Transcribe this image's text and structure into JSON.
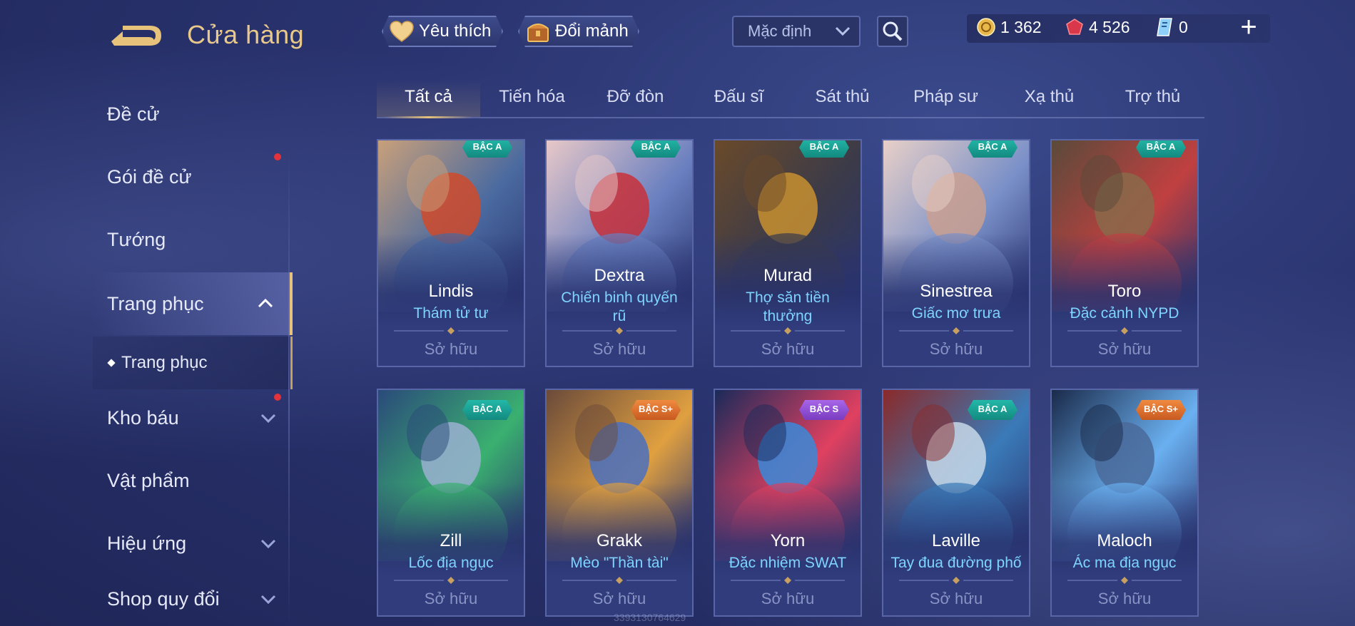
{
  "header": {
    "title": "Cửa hàng",
    "favorites_label": "Yêu thích",
    "fragments_label": "Đổi mảnh",
    "sort_value": "Mặc định",
    "currency": {
      "gold": "1 362",
      "ruby": "4 526",
      "voucher": "0"
    },
    "add_symbol": "+"
  },
  "sidebar": {
    "items": [
      {
        "label": "Đề cử"
      },
      {
        "label": "Gói đề cử"
      },
      {
        "label": "Tướng"
      },
      {
        "label": "Trang phục"
      },
      {
        "label": "Trang phục"
      },
      {
        "label": "Kho báu"
      },
      {
        "label": "Vật phẩm"
      },
      {
        "label": "Hiệu ứng"
      },
      {
        "label": "Shop quy đổi"
      }
    ]
  },
  "tabs": [
    "Tất cả",
    "Tiến hóa",
    "Đỡ đòn",
    "Đấu sĩ",
    "Sát thủ",
    "Pháp sư",
    "Xạ thủ",
    "Trợ thủ"
  ],
  "cards": [
    {
      "hero": "Lindis",
      "skin": "Thám tử tư",
      "skin2": "",
      "tier": "BẬC A",
      "status": "Sở hữu"
    },
    {
      "hero": "Dextra",
      "skin": "Chiến binh quyến",
      "skin2": "rũ",
      "tier": "BẬC A",
      "status": "Sở hữu"
    },
    {
      "hero": "Murad",
      "skin": "Thợ săn tiền",
      "skin2": "thưởng",
      "tier": "BẬC A",
      "status": "Sở hữu"
    },
    {
      "hero": "Sinestrea",
      "skin": "Giấc mơ trưa",
      "skin2": "",
      "tier": "BẬC A",
      "status": "Sở hữu"
    },
    {
      "hero": "Toro",
      "skin": "Đặc cảnh NYPD",
      "skin2": "",
      "tier": "BẬC A",
      "status": "Sở hữu"
    },
    {
      "hero": "Zill",
      "skin": "Lốc địa ngục",
      "skin2": "",
      "tier": "BẬC A",
      "status": "Sở hữu"
    },
    {
      "hero": "Grakk",
      "skin": "Mèo \"Thần tài\"",
      "skin2": "",
      "tier": "BẬC S+",
      "status": "Sở hữu"
    },
    {
      "hero": "Yorn",
      "skin": "Đặc nhiệm SWAT",
      "skin2": "",
      "tier": "BẬC S",
      "status": "Sở hữu"
    },
    {
      "hero": "Laville",
      "skin": "Tay đua đường phố",
      "skin2": "",
      "tier": "BẬC A",
      "status": "Sở hữu"
    },
    {
      "hero": "Maloch",
      "skin": "Ác ma địa ngục",
      "skin2": "",
      "tier": "BẬC S+",
      "status": "Sở hữu"
    }
  ],
  "watermark": "3393130764629",
  "colors": {
    "accent_gold": "#e6c27a",
    "skin_name": "#7ed4ff",
    "badge_a": "#23b8a8",
    "badge_s": "#a866e8",
    "badge_s_plus": "#f08a40",
    "notification": "#e3323a"
  },
  "icons": {
    "back": "back-arrow-icon",
    "favorites": "heart-icon",
    "fragments": "chest-icon",
    "search": "search-icon",
    "gold": "gold-coin-icon",
    "ruby": "ruby-gem-icon",
    "voucher": "voucher-icon"
  }
}
